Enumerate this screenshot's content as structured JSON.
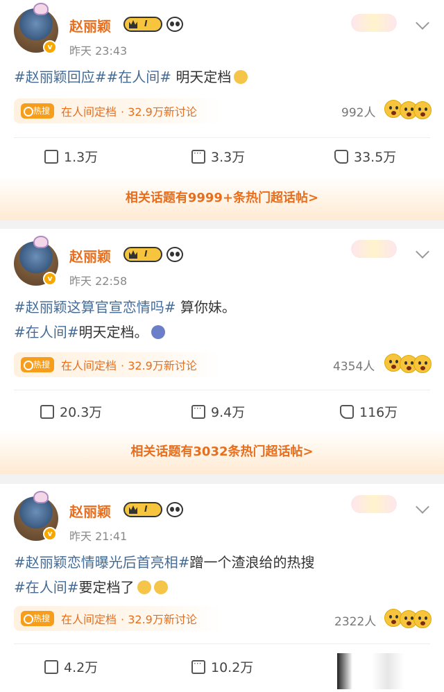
{
  "posts": [
    {
      "username": "赵丽颖",
      "level": "I",
      "verified_badge": "v",
      "time": "昨天 23:43",
      "text_segments": [
        "#赵丽颖回应#",
        "#在人间#",
        " 明天定档"
      ],
      "text_line2": [],
      "hot_badge": "热搜",
      "hot_title": "在人间定档",
      "hot_sub": "· 32.9万新讨论",
      "reaction_count": "992人",
      "repost": "1.3万",
      "comment": "3.3万",
      "like": "33.5万",
      "banner": "相关话题有9999+条热门超话帖>"
    },
    {
      "username": "赵丽颖",
      "level": "I",
      "verified_badge": "v",
      "time": "昨天 22:58",
      "text_segments": [
        "#赵丽颖这算官宣恋情吗#",
        " 算你妹。"
      ],
      "text_line2": [
        "#在人间#",
        "明天定档。"
      ],
      "hot_badge": "热搜",
      "hot_title": "在人间定档",
      "hot_sub": "· 32.9万新讨论",
      "reaction_count": "4354人",
      "repost": "20.3万",
      "comment": "9.4万",
      "like": "116万",
      "banner": "相关话题有3032条热门超话帖>"
    },
    {
      "username": "赵丽颖",
      "level": "I",
      "verified_badge": "v",
      "time": "昨天 21:41",
      "text_segments": [
        "#赵丽颖恋情曝光后首亮相#",
        "蹭一个渣浪给的热搜"
      ],
      "text_line2": [
        "#在人间#",
        "要定档了"
      ],
      "hot_badge": "热搜",
      "hot_title": "在人间定档",
      "hot_sub": "· 32.9万新讨论",
      "reaction_count": "2322人",
      "repost": "4.2万",
      "comment": "10.2万",
      "like": ""
    }
  ],
  "colors": {
    "username": "#e86e1d",
    "hashtag": "#446b96",
    "hot_badge": "#f79d1c",
    "background": "#f2f2f2"
  },
  "icons": [
    "avatar",
    "crown-level-icon",
    "panda-icon",
    "chevron-down-icon",
    "repost-icon",
    "comment-icon",
    "like-icon",
    "emoji-reaction-icon"
  ]
}
